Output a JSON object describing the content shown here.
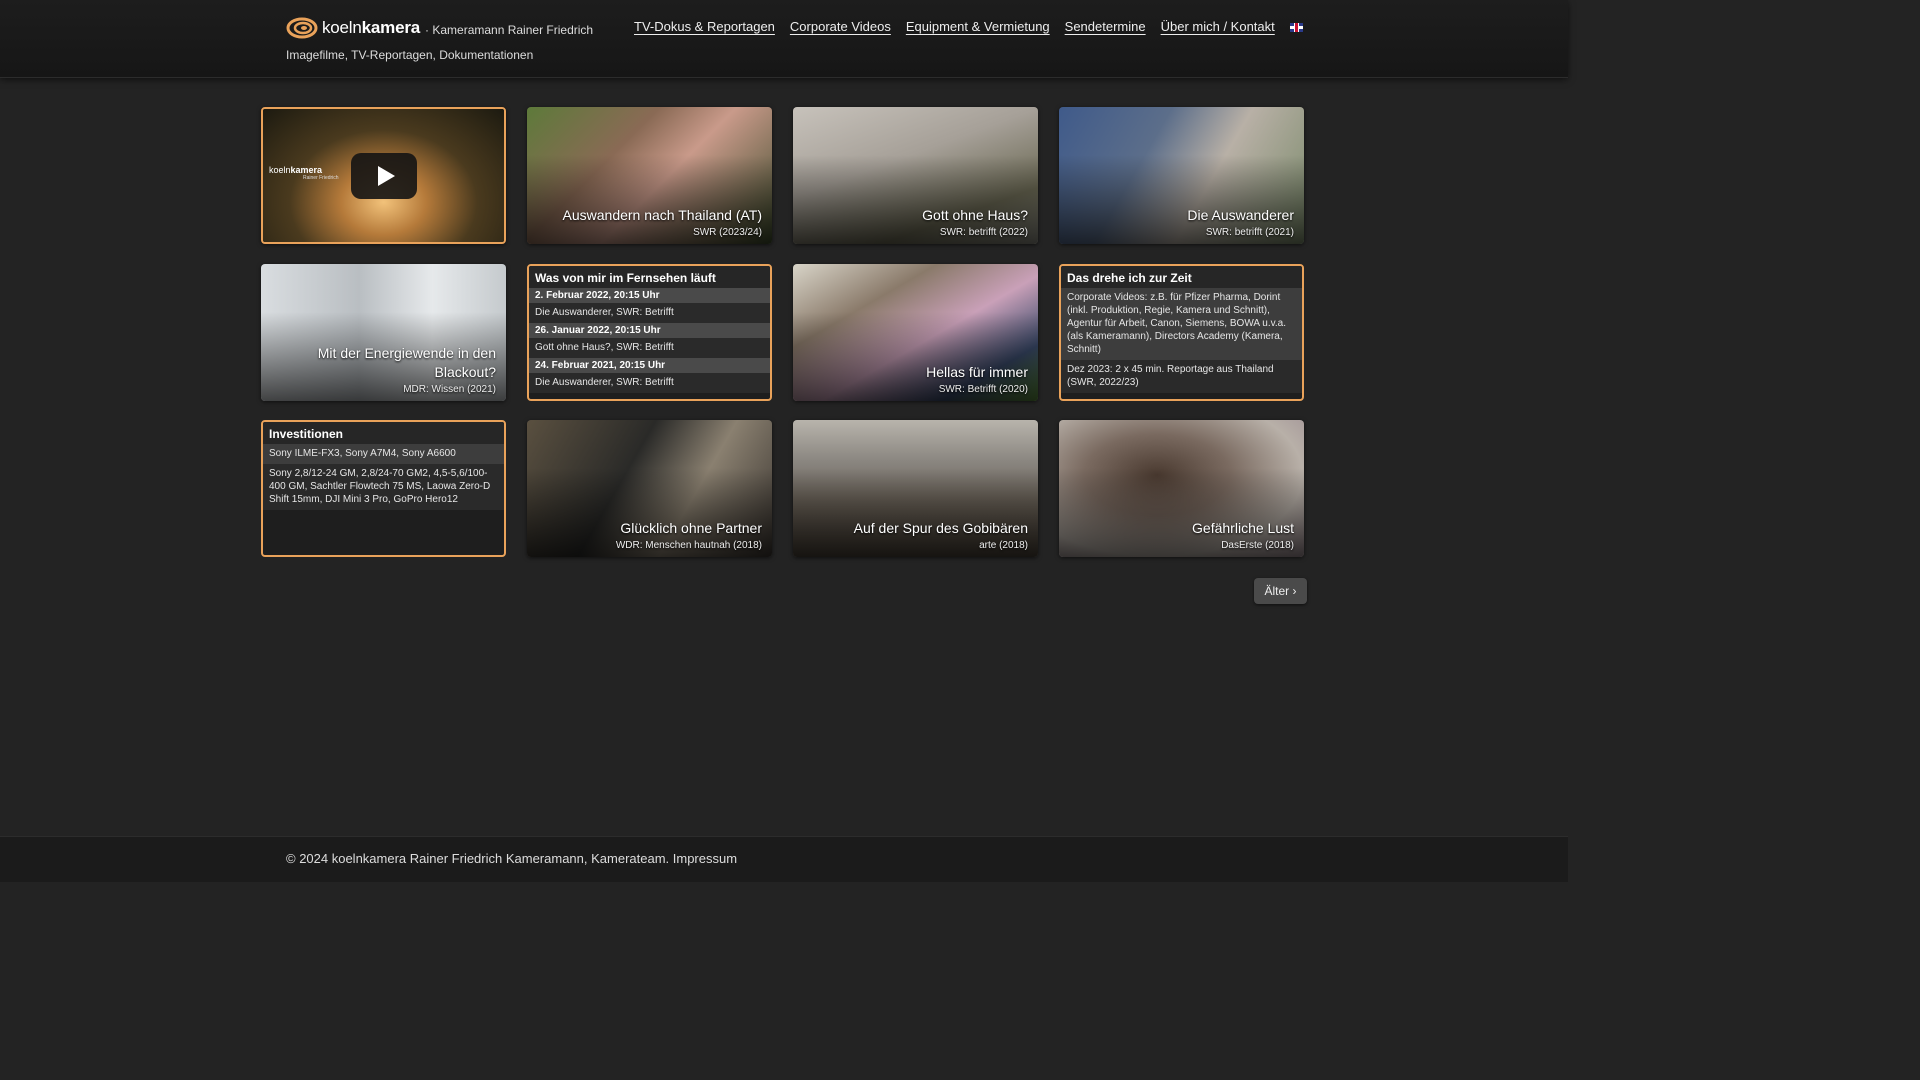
{
  "header": {
    "logo_light": "koeln",
    "logo_bold": "kamera",
    "subtitle": "· Kameramann Rainer Friedrich",
    "tagline": "Imagefilme, TV-Reportagen, Dokumentationen",
    "nav": [
      {
        "label": "TV-Dokus & Reportagen"
      },
      {
        "label": "Corporate Videos"
      },
      {
        "label": "Equipment & Vermietung"
      },
      {
        "label": "Sendetermine"
      },
      {
        "label": "Über mich / Kontakt"
      }
    ],
    "language_icon": "uk-flag-icon"
  },
  "intro_video": {
    "logo_light": "koeln",
    "logo_bold": "kamera",
    "logo_sub": "Rainer Friedrich",
    "play_icon": "play-icon"
  },
  "tiles": [
    {
      "title": "Auswandern nach Thailand (AT)",
      "sub": "SWR (2023/24)"
    },
    {
      "title": "Gott ohne Haus?",
      "sub": "SWR: betrifft (2022)"
    },
    {
      "title": "Die Auswanderer",
      "sub": "SWR: betrifft (2021)"
    },
    {
      "title": "Mit der Energiewende in den Blackout?",
      "sub": "MDR: Wissen (2021)"
    },
    {
      "title": "Hellas für immer",
      "sub": "SWR: Betrifft (2020)"
    },
    {
      "title": "Glücklich ohne Partner",
      "sub": "WDR: Menschen hautnah (2018)"
    },
    {
      "title": "Auf der Spur des Gobibären",
      "sub": "arte (2018)"
    },
    {
      "title": "Gefährliche Lust",
      "sub": "DasErste (2018)"
    }
  ],
  "tv_box": {
    "heading": "Was von mir im Fernsehen läuft",
    "entries": [
      {
        "date": "2. Februar 2022, 20:15 Uhr",
        "text": "Die Auswanderer, SWR: Betrifft"
      },
      {
        "date": "26. Januar 2022, 20:15 Uhr",
        "text": "Gott ohne Haus?, SWR: Betrifft"
      },
      {
        "date": "24. Februar 2021, 20:15 Uhr",
        "text": "Die Auswanderer, SWR: Betrifft"
      }
    ]
  },
  "current_box": {
    "heading": "Das drehe ich zur Zeit",
    "items": [
      "Corporate Videos: z.B. für Pfizer Pharma, Dorint (inkl. Produktion, Regie, Kamera und Schnitt), Agentur für Arbeit, Canon, Siemens, BOWA u.v.a. (als Kameramann), Directors Academy (Kamera, Schnitt)",
      "Dez 2023: 2 x 45 min. Reportage aus Thailand (SWR, 2022/23)"
    ]
  },
  "invest_box": {
    "heading": "Investitionen",
    "items": [
      "Sony ILME-FX3, Sony A7M4, Sony A6600",
      "Sony 2,8/12-24 GM, 2,8/24-70 GM2, 4,5-5,6/100-400 GM, Sachtler Flowtech 75 MS, Laowa Zero-D Shift 15mm, DJI Mini 3 Pro, GoPro Hero12"
    ]
  },
  "pagination": {
    "older_label": "Älter ›"
  },
  "footer": {
    "text": "© 2024 koelnkamera Rainer Friedrich Kameramann, Kamerateam. Impressum"
  },
  "colors": {
    "accent": "#e9a25a",
    "background": "#232323"
  }
}
